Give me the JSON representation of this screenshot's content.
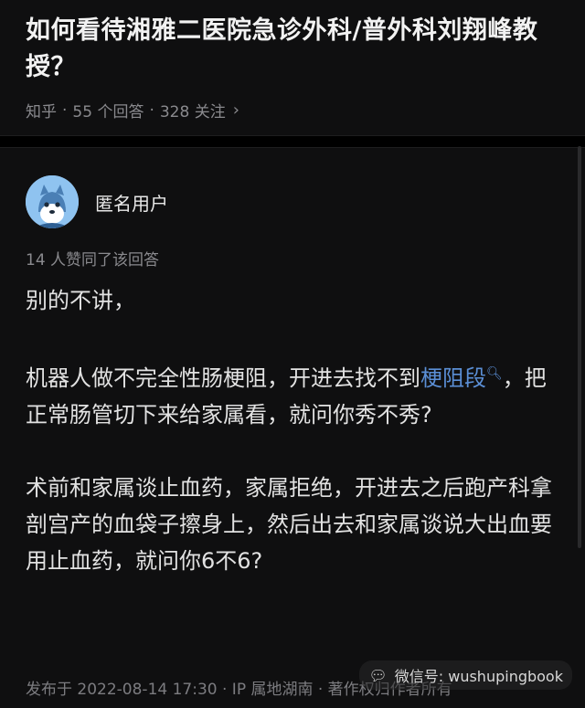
{
  "question": {
    "title": "如何看待湘雅二医院急诊外科/普外科刘翔峰教授？",
    "source": "知乎",
    "sep1": "·",
    "answers": "55 个回答",
    "sep2": "·",
    "followers": "328 关注",
    "chevron_icon": "chevron-right-icon"
  },
  "answer": {
    "author_name": "匿名用户",
    "avatar_icon": "anonymous-avatar-icon",
    "votes_text": "14 人赞同了该回答",
    "paragraphs": {
      "p1": "别的不讲，",
      "p2_before": "机器人做不完全性肠梗阻，开进去找不到",
      "p2_link": "梗阻段",
      "p2_after": "，把正常肠管切下来给家属看，就问你秀不秀?",
      "p3": "术前和家属谈止血药，家属拒绝，开进去之后跑产科拿剖宫产的血袋子擦身上，然后出去和家属谈说大出血要用止血药，就问你6不6?"
    },
    "footer": "发布于 2022-08-14 17:30 · IP 属地湖南 · 著作权归作者所有"
  },
  "watermark": {
    "icon": "wechat-icon",
    "text": "微信号: wushupingbook"
  },
  "colors": {
    "background": "#0f0f10",
    "link": "#5b8fd6",
    "meta": "#8a8a8e"
  }
}
